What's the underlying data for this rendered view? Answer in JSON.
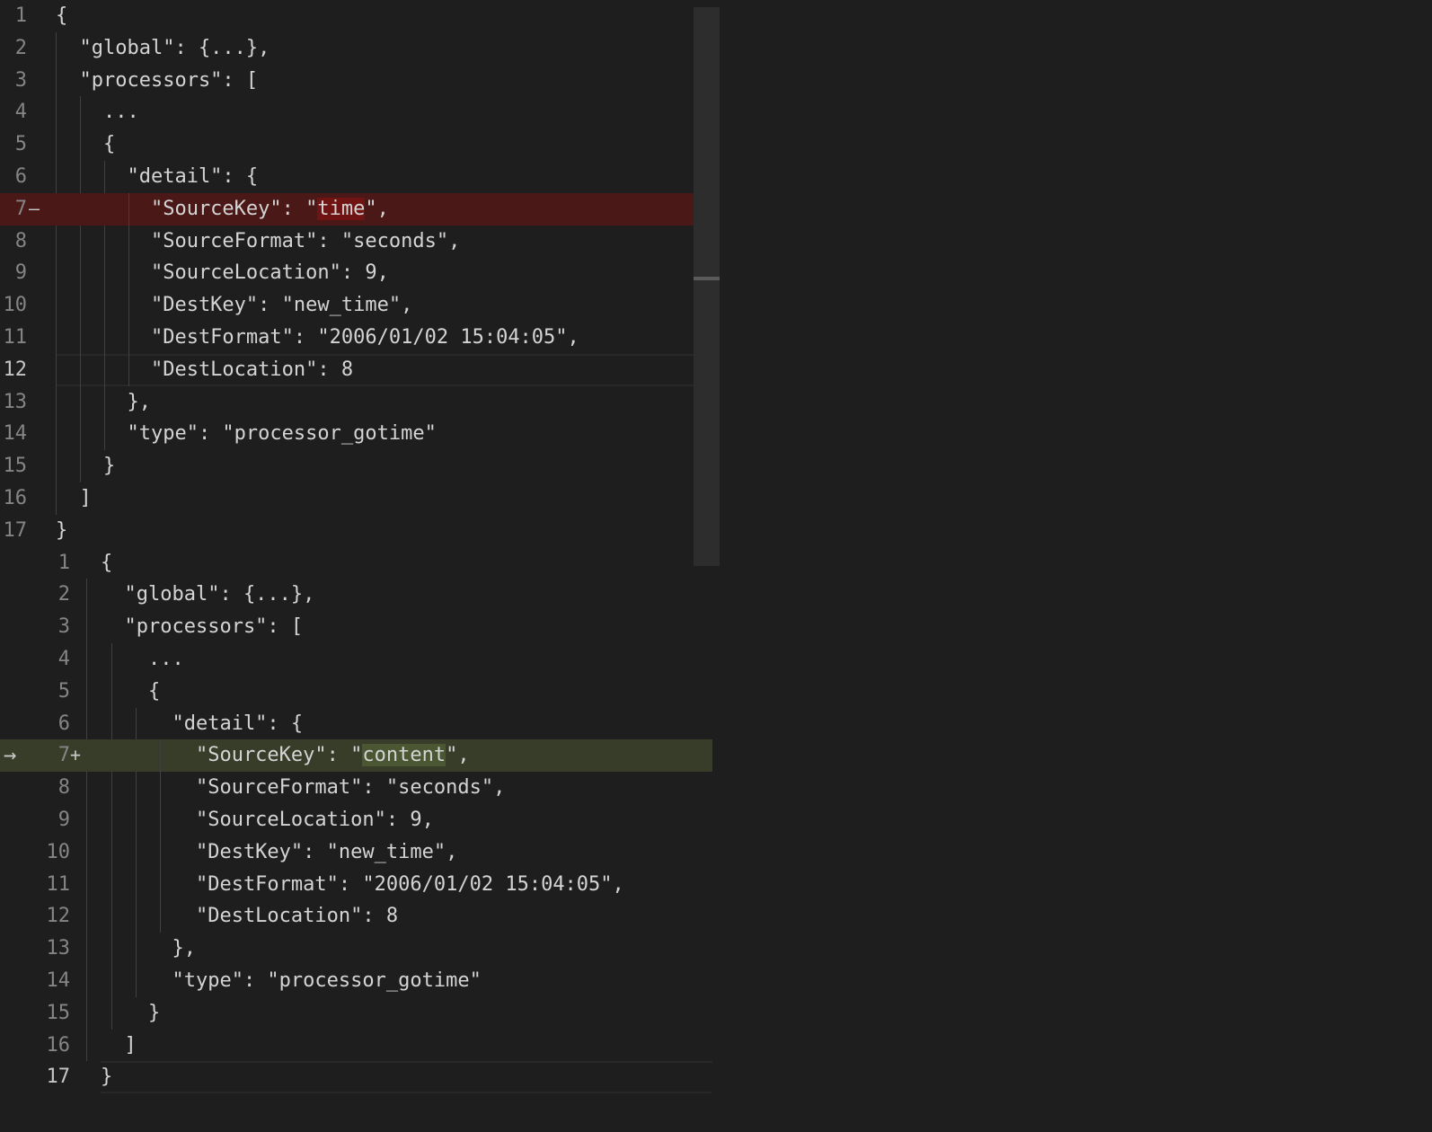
{
  "diff_editor": {
    "left": {
      "lines": [
        {
          "num": "1",
          "text": "{"
        },
        {
          "num": "2",
          "text": "  \"global\": {...},"
        },
        {
          "num": "3",
          "text": "  \"processors\": ["
        },
        {
          "num": "4",
          "text": "    ..."
        },
        {
          "num": "5",
          "text": "    {"
        },
        {
          "num": "6",
          "text": "      \"detail\": {"
        },
        {
          "num": "7",
          "sign": "—",
          "before": "        \"SourceKey\": \"",
          "changed": "time",
          "after": "\","
        },
        {
          "num": "8",
          "text": "        \"SourceFormat\": \"seconds\","
        },
        {
          "num": "9",
          "text": "        \"SourceLocation\": 9,"
        },
        {
          "num": "10",
          "text": "        \"DestKey\": \"new_time\","
        },
        {
          "num": "11",
          "text": "        \"DestFormat\": \"2006/01/02 15:04:05\","
        },
        {
          "num": "12",
          "text": "        \"DestLocation\": 8"
        },
        {
          "num": "13",
          "text": "      },"
        },
        {
          "num": "14",
          "text": "      \"type\": \"processor_gotime\""
        },
        {
          "num": "15",
          "text": "    }"
        },
        {
          "num": "16",
          "text": "  ]"
        },
        {
          "num": "17",
          "text": "}"
        }
      ]
    },
    "right": {
      "arrow": "→",
      "lines": [
        {
          "num": "1",
          "text": "{"
        },
        {
          "num": "2",
          "text": "  \"global\": {...},"
        },
        {
          "num": "3",
          "text": "  \"processors\": ["
        },
        {
          "num": "4",
          "text": "    ..."
        },
        {
          "num": "5",
          "text": "    {"
        },
        {
          "num": "6",
          "text": "      \"detail\": {"
        },
        {
          "num": "7",
          "sign": "+",
          "before": "        \"SourceKey\": \"",
          "changed": "content",
          "after": "\","
        },
        {
          "num": "8",
          "text": "        \"SourceFormat\": \"seconds\","
        },
        {
          "num": "9",
          "text": "        \"SourceLocation\": 9,"
        },
        {
          "num": "10",
          "text": "        \"DestKey\": \"new_time\","
        },
        {
          "num": "11",
          "text": "        \"DestFormat\": \"2006/01/02 15:04:05\","
        },
        {
          "num": "12",
          "text": "        \"DestLocation\": 8"
        },
        {
          "num": "13",
          "text": "      },"
        },
        {
          "num": "14",
          "text": "      \"type\": \"processor_gotime\""
        },
        {
          "num": "15",
          "text": "    }"
        },
        {
          "num": "16",
          "text": "  ]"
        },
        {
          "num": "17",
          "text": "}"
        }
      ]
    }
  },
  "colors": {
    "background": "#1e1e1e",
    "removed_line": "#4b1818",
    "removed_text": "#6f1313",
    "inserted_line": "#373d29",
    "inserted_text": "#4b5632"
  }
}
